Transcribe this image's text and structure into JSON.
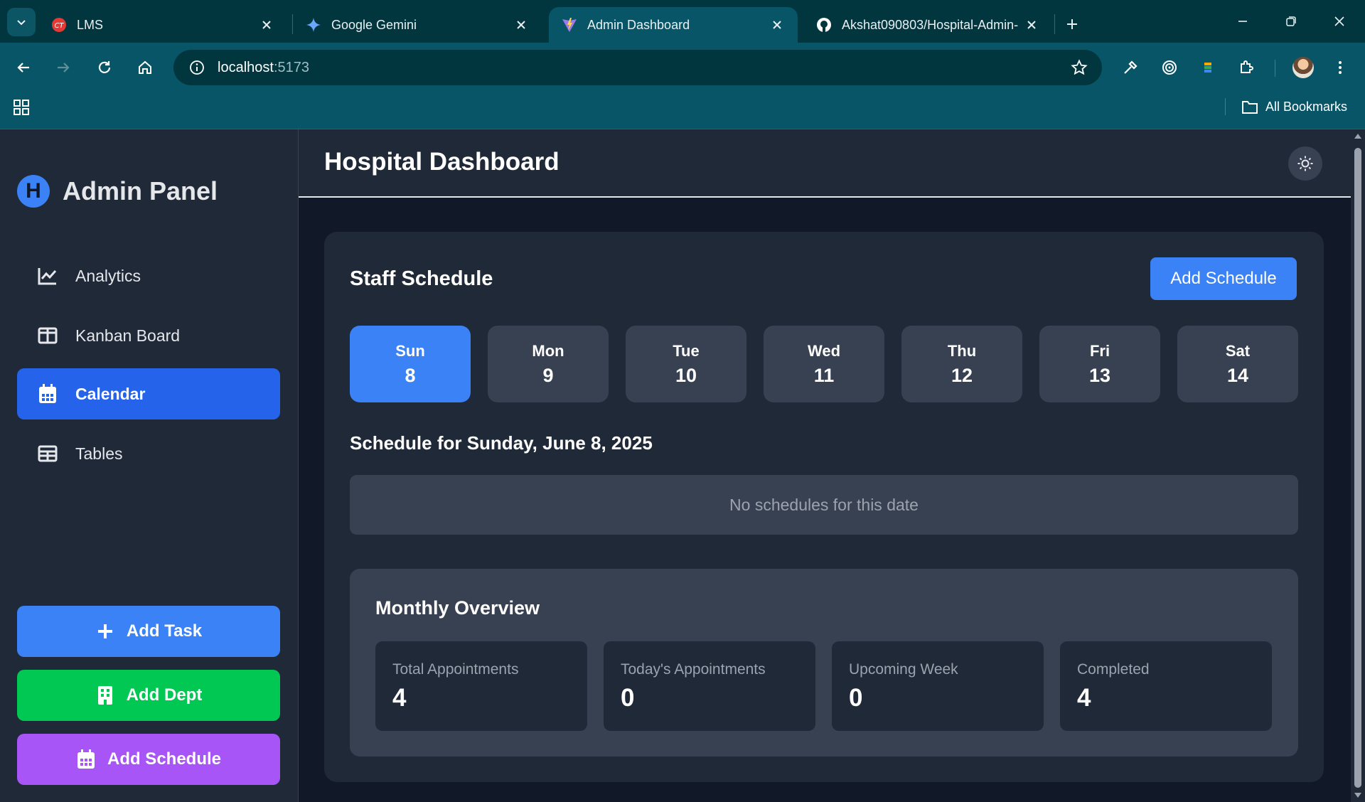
{
  "browser": {
    "tabs": [
      {
        "title": "LMS",
        "favicon": "lms-icon",
        "active": false
      },
      {
        "title": "Google Gemini",
        "favicon": "gemini-icon",
        "active": false
      },
      {
        "title": "Admin Dashboard",
        "favicon": "vite-icon",
        "active": true
      },
      {
        "title": "Akshat090803/Hospital-Admin-",
        "favicon": "github-icon",
        "active": false
      }
    ],
    "url_host": "localhost",
    "url_port": ":5173",
    "bookmarks_label": "All Bookmarks",
    "chrome_color": "#075566"
  },
  "sidebar": {
    "logo_letter": "H",
    "title": "Admin Panel",
    "nav": [
      {
        "label": "Analytics",
        "icon": "chart-line-icon",
        "active": false
      },
      {
        "label": "Kanban Board",
        "icon": "columns-icon",
        "active": false
      },
      {
        "label": "Calendar",
        "icon": "calendar-icon",
        "active": true
      },
      {
        "label": "Tables",
        "icon": "table-icon",
        "active": false
      }
    ],
    "actions": [
      {
        "label": "Add Task",
        "icon": "plus-icon",
        "color": "#3b82f6"
      },
      {
        "label": "Add Dept",
        "icon": "building-icon",
        "color": "#00c853"
      },
      {
        "label": "Add Schedule",
        "icon": "calendar-icon",
        "color": "#a855f7"
      }
    ]
  },
  "header": {
    "title": "Hospital Dashboard",
    "theme_toggle_icon": "sun-icon"
  },
  "schedule": {
    "title": "Staff Schedule",
    "add_button": "Add Schedule",
    "days": [
      {
        "name": "Sun",
        "date": "8",
        "selected": true
      },
      {
        "name": "Mon",
        "date": "9",
        "selected": false
      },
      {
        "name": "Tue",
        "date": "10",
        "selected": false
      },
      {
        "name": "Wed",
        "date": "11",
        "selected": false
      },
      {
        "name": "Thu",
        "date": "12",
        "selected": false
      },
      {
        "name": "Fri",
        "date": "13",
        "selected": false
      },
      {
        "name": "Sat",
        "date": "14",
        "selected": false
      }
    ],
    "selected_heading": "Schedule for Sunday, June 8, 2025",
    "empty_message": "No schedules for this date"
  },
  "overview": {
    "title": "Monthly Overview",
    "stats": [
      {
        "label": "Total Appointments",
        "value": "4"
      },
      {
        "label": "Today's Appointments",
        "value": "0"
      },
      {
        "label": "Upcoming Week",
        "value": "0"
      },
      {
        "label": "Completed",
        "value": "4"
      }
    ]
  },
  "colors": {
    "accent": "#3b82f6",
    "active_nav": "#2563eb",
    "panel": "#1f2937",
    "background": "#111827"
  }
}
